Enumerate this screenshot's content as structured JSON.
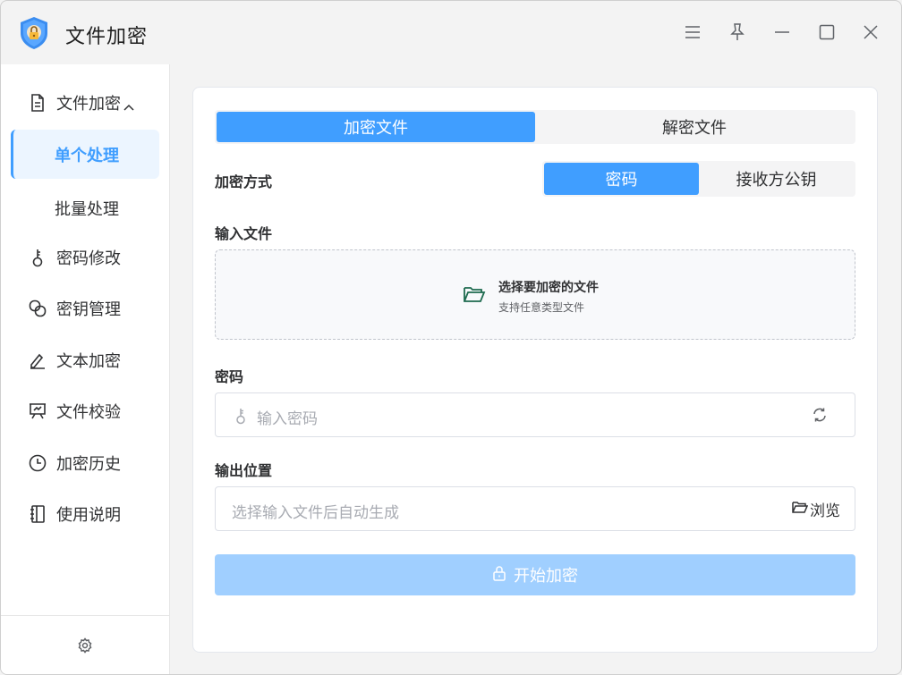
{
  "app": {
    "title": "文件加密",
    "logo_icon": "shield-lock-icon"
  },
  "titlebar": {
    "buttons": [
      "menu-icon",
      "pin-icon",
      "minimize-icon",
      "maximize-icon",
      "close-icon"
    ]
  },
  "sidebar": {
    "group": {
      "label": "文件加密",
      "icon": "document-icon",
      "expanded": true
    },
    "sub_items": [
      {
        "label": "单个处理",
        "active": true
      },
      {
        "label": "批量处理",
        "active": false
      }
    ],
    "items": [
      {
        "label": "密码修改",
        "icon": "key-icon"
      },
      {
        "label": "密钥管理",
        "icon": "link-icon"
      },
      {
        "label": "文本加密",
        "icon": "pen-icon"
      },
      {
        "label": "文件校验",
        "icon": "presentation-icon"
      },
      {
        "label": "加密历史",
        "icon": "clock-icon"
      },
      {
        "label": "使用说明",
        "icon": "notebook-icon"
      }
    ],
    "footer_icon": "settings-icon"
  },
  "main": {
    "mode_tabs": [
      {
        "label": "加密文件",
        "active": true
      },
      {
        "label": "解密文件",
        "active": false
      }
    ],
    "method": {
      "label": "加密方式",
      "options": [
        {
          "label": "密码",
          "active": true
        },
        {
          "label": "接收方公钥",
          "active": false
        }
      ]
    },
    "input_file": {
      "label": "输入文件",
      "drop_title": "选择要加密的文件",
      "drop_subtitle": "支持任意类型文件"
    },
    "password": {
      "label": "密码",
      "placeholder": "输入密码"
    },
    "output": {
      "label": "输出位置",
      "placeholder": "选择输入文件后自动生成",
      "browse_label": "浏览"
    },
    "start_button": {
      "label": "开始加密",
      "enabled": false
    }
  },
  "colors": {
    "accent": "#409eff",
    "accent_light": "#ecf5ff",
    "disabled_button": "#a0cfff",
    "folder_green": "#1e6b4f"
  }
}
